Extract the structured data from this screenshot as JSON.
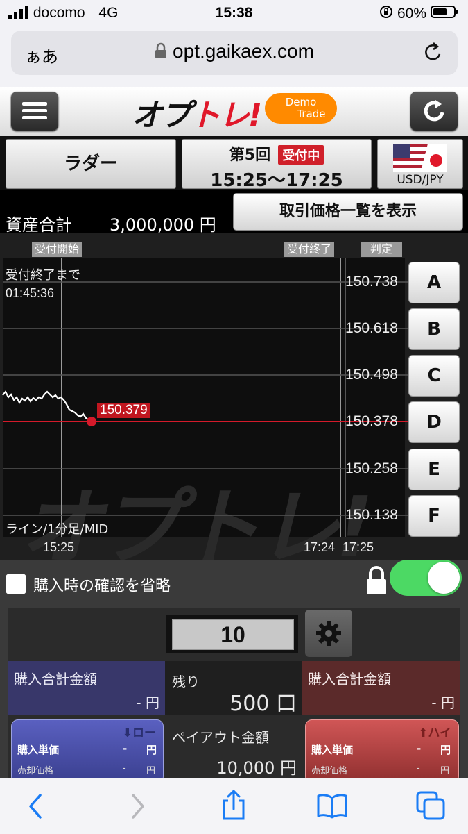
{
  "status": {
    "carrier": "docomo",
    "network": "4G",
    "time": "15:38",
    "battery": "60%"
  },
  "browser": {
    "aa": "ぁあ",
    "url": "opt.gaikaex.com"
  },
  "app": {
    "logo": "オプトレ!",
    "demo_line1": "Demo",
    "demo_line2": "Trade"
  },
  "info": {
    "type": "ラダー",
    "round": "第5回",
    "status_badge": "受付中",
    "period": "15:25〜17:25",
    "pair": "USD/JPY"
  },
  "assets": {
    "label": "資産合計",
    "value": "3,000,000 円",
    "button": "取引価格一覧を表示"
  },
  "chart": {
    "tag_start": "受付開始",
    "tag_end": "受付終了",
    "tag_judge": "判定",
    "countdown_label": "受付終了まで",
    "countdown": "01:45:36",
    "current_price": "150.379",
    "mode": "ライン/1分足/MID",
    "time_start": "15:25",
    "time_end": "17:24",
    "time_judge": "17:25",
    "watermark": "オプトレ!",
    "levels": [
      {
        "price": "150.738",
        "letter": "A"
      },
      {
        "price": "150.618",
        "letter": "B"
      },
      {
        "price": "150.498",
        "letter": "C"
      },
      {
        "price": "150.378",
        "letter": "D"
      },
      {
        "price": "150.258",
        "letter": "E"
      },
      {
        "price": "150.138",
        "letter": "F"
      }
    ],
    "line_color": "#d41a2a"
  },
  "options": {
    "skip_confirm": "購入時の確認を省略",
    "toggle_on": true
  },
  "order": {
    "quantity": "10",
    "left_total_label": "購入合計金額",
    "left_total_value": "- 円",
    "remaining_label": "残り",
    "remaining_value": "500 口",
    "right_total_label": "購入合計金額",
    "right_total_value": "- 円",
    "low_label": "ロー",
    "high_label": "ハイ",
    "buy_unit": "購入単価",
    "sell_price": "売却価格",
    "dash": "-",
    "yen": "円",
    "payout_label": "ペイアウト金額",
    "payout_value": "10,000 円"
  },
  "colors": {
    "toggle_green": "#4cd964",
    "low_blue": "#3a3f8f",
    "high_red": "#8f2f2f",
    "badge_red": "#d0202a"
  }
}
